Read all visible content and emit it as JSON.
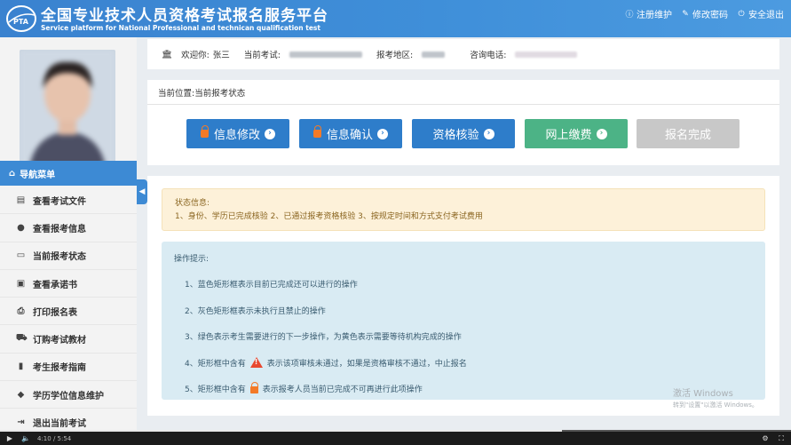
{
  "header": {
    "title_cn": "全国专业技术人员资格考试报名服务平台",
    "title_en": "Service platform for National Professional and technican qualification test",
    "logo_text": "PTA",
    "links": [
      {
        "label": "注册维护",
        "icon": "info-icon"
      },
      {
        "label": "修改密码",
        "icon": "edit-icon"
      },
      {
        "label": "安全退出",
        "icon": "power-icon"
      }
    ]
  },
  "info_bar": {
    "welcome_label": "欢迎你:",
    "welcome_name": "张三",
    "exam_label": "当前考试:",
    "region_label": "报考地区:",
    "phone_label": "咨询电话:"
  },
  "location": {
    "label": "当前位置:",
    "value": "当前报考状态"
  },
  "steps": [
    {
      "label": "信息修改",
      "state": "locked"
    },
    {
      "label": "信息确认",
      "state": "locked"
    },
    {
      "label": "资格核验",
      "state": "active"
    },
    {
      "label": "网上缴费",
      "state": "next"
    },
    {
      "label": "报名完成",
      "state": "disabled"
    }
  ],
  "status": {
    "title": "状态信息:",
    "text": "1、身份、学历已完成核验 2、已通过报考资格核验 3、按规定时间和方式支付考试费用"
  },
  "tips": {
    "title": "操作提示:",
    "items": [
      "1、蓝色矩形框表示目前已完成还可以进行的操作",
      "2、灰色矩形框表示未执行且禁止的操作",
      "3、绿色表示考生需要进行的下一步操作，为黄色表示需要等待机构完成的操作",
      {
        "before": "4、矩形框中含有",
        "after": "表示该项审核未通过，如果是资格审核不通过，中止报名"
      },
      {
        "before": "5、矩形框中含有",
        "after": "表示报考人员当前已完成不可再进行此项操作"
      }
    ]
  },
  "sidebar": {
    "nav_title": "导航菜单",
    "items": [
      {
        "label": "查看考试文件",
        "icon": "file-icon"
      },
      {
        "label": "查看报考信息",
        "icon": "info-circle-icon"
      },
      {
        "label": "当前报考状态",
        "icon": "monitor-icon"
      },
      {
        "label": "查看承诺书",
        "icon": "card-icon"
      },
      {
        "label": "打印报名表",
        "icon": "print-icon"
      },
      {
        "label": "订购考试教材",
        "icon": "cart-icon"
      },
      {
        "label": "考生报考指南",
        "icon": "book-icon"
      },
      {
        "label": "学历学位信息维护",
        "icon": "graduation-cap-icon"
      },
      {
        "label": "退出当前考试",
        "icon": "exit-icon"
      }
    ]
  },
  "watermark": {
    "line1": "激活 Windows",
    "line2": "转到\"设置\"以激活 Windows。"
  },
  "player": {
    "time": "4:10 / 5:54",
    "progress": 0.71
  },
  "colors": {
    "header": "#3f8fd9",
    "button_blue": "#2e7dca",
    "button_green": "#4cb386",
    "button_gray": "#c8c8c8",
    "lock": "#f37a28",
    "warning": "#e8482f"
  }
}
